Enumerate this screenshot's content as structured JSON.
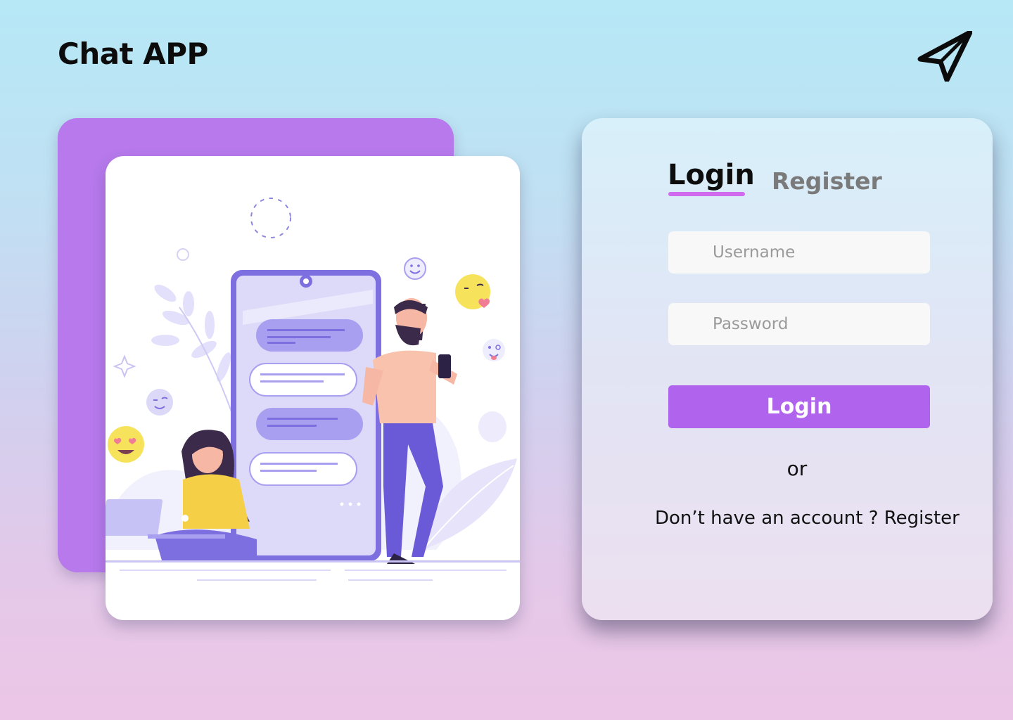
{
  "header": {
    "title": "Chat APP",
    "logo_icon": "paper-plane-icon"
  },
  "illustration": {
    "description_icons": [
      "smiley-icon",
      "kiss-emoji-icon",
      "heart-eyes-emoji-icon",
      "wink-emoji-icon",
      "tongue-emoji-icon",
      "phone-icon",
      "person-icon",
      "laptop-icon"
    ]
  },
  "auth": {
    "tabs": {
      "login": "Login",
      "register": "Register",
      "active": "login"
    },
    "username_placeholder": "Username",
    "password_placeholder": "Password",
    "submit_label": "Login",
    "divider": "or",
    "signup_prompt": "Don’t have an account ?",
    "signup_link": "Register"
  },
  "colors": {
    "accent": "#b063ec",
    "tab_underline": "#d06bf0",
    "purple_card": "#b779ec"
  }
}
